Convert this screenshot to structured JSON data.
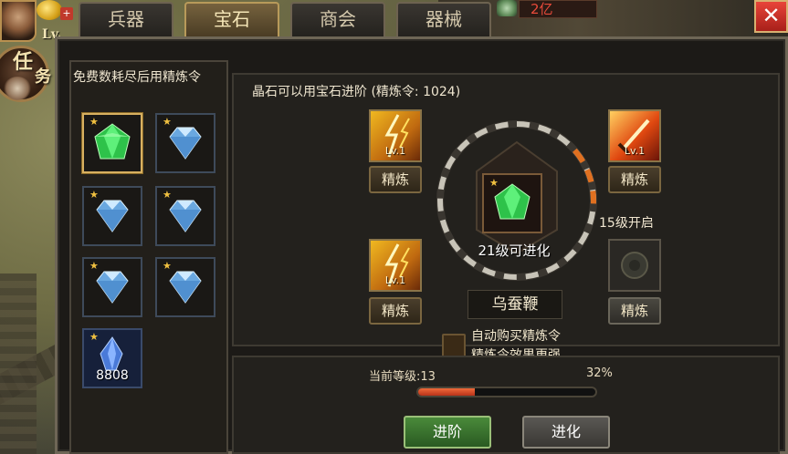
{
  "header": {
    "level_prefix": "Lv.",
    "task_label_1": "任",
    "task_label_2": "务",
    "currency_value": "2亿",
    "plus": "+",
    "close_symbol": "✕"
  },
  "tabs": [
    {
      "label": "兵器",
      "active": false
    },
    {
      "label": "宝石",
      "active": true
    },
    {
      "label": "商会",
      "active": false
    },
    {
      "label": "器械",
      "active": false
    }
  ],
  "left_panel": {
    "title": "免费数耗尽后用精炼令",
    "gems": [
      {
        "type": "emerald",
        "selected": true,
        "star": "★"
      },
      {
        "type": "diamond",
        "selected": false,
        "star": "★"
      },
      {
        "type": "diamond",
        "selected": false,
        "star": "★"
      },
      {
        "type": "diamond",
        "selected": false,
        "star": "★"
      },
      {
        "type": "diamond",
        "selected": false,
        "star": "★"
      },
      {
        "type": "diamond",
        "selected": false,
        "star": "★"
      },
      {
        "type": "crystal",
        "selected": false,
        "star": "★",
        "count": "8808"
      }
    ]
  },
  "right_panel": {
    "title": "晶石可以用宝石进阶 (精炼令: 1024)",
    "slots": [
      {
        "level": "Lv.1",
        "button": "精炼",
        "theme": "gold"
      },
      {
        "level": "Lv.1",
        "button": "精炼",
        "theme": "red"
      },
      {
        "level": "Lv.1",
        "button": "精炼",
        "theme": "gold"
      },
      {
        "level": "",
        "button": "精炼",
        "theme": "locked"
      }
    ],
    "unlock_text": "15级开启",
    "center": {
      "star": "★",
      "evolve_text": "21级可进化",
      "weapon_name": "乌蚕鞭"
    },
    "auto_buy": {
      "line1": "自动购买精炼令",
      "line2": "精炼令效果更强"
    }
  },
  "bottom_panel": {
    "level_text": "当前等级:13",
    "progress_text": "32%",
    "progress_fraction": 0.32,
    "advance_button": "进阶",
    "evolve_button": "进化"
  },
  "colors": {
    "accent_gold": "#d8b060",
    "progress_red": "#e0502a",
    "green_button": "#3a7a30"
  }
}
